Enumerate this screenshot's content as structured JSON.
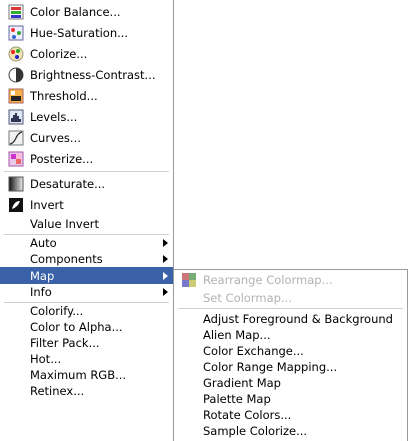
{
  "main_menu": {
    "items": [
      {
        "label": "Color Balance...",
        "icon": "color-balance-icon"
      },
      {
        "label": "Hue-Saturation...",
        "icon": "hue-saturation-icon"
      },
      {
        "label": "Colorize...",
        "icon": "colorize-icon"
      },
      {
        "label": "Brightness-Contrast...",
        "icon": "brightness-contrast-icon"
      },
      {
        "label": "Threshold...",
        "icon": "threshold-icon"
      },
      {
        "label": "Levels...",
        "icon": "levels-icon"
      },
      {
        "label": "Curves...",
        "icon": "curves-icon"
      },
      {
        "label": "Posterize...",
        "icon": "posterize-icon"
      },
      {
        "label": "Desaturate...",
        "icon": "desaturate-icon"
      },
      {
        "label": "Invert",
        "icon": "invert-icon"
      },
      {
        "label": "Value Invert"
      },
      {
        "label": "Auto",
        "submenu": true
      },
      {
        "label": "Components",
        "submenu": true
      },
      {
        "label": "Map",
        "submenu": true,
        "active": true
      },
      {
        "label": "Info",
        "submenu": true
      },
      {
        "label": "Colorify..."
      },
      {
        "label": "Color to Alpha..."
      },
      {
        "label": "Filter Pack..."
      },
      {
        "label": "Hot..."
      },
      {
        "label": "Maximum RGB..."
      },
      {
        "label": "Retinex..."
      }
    ]
  },
  "map_submenu": {
    "items": [
      {
        "label": "Rearrange Colormap...",
        "disabled": true,
        "icon": "rearrange-colormap-icon"
      },
      {
        "label": "Set Colormap...",
        "disabled": true
      },
      {
        "label": "Adjust Foreground & Background"
      },
      {
        "label": "Alien Map..."
      },
      {
        "label": "Color Exchange..."
      },
      {
        "label": "Color Range Mapping..."
      },
      {
        "label": "Gradient Map"
      },
      {
        "label": "Palette Map"
      },
      {
        "label": "Rotate Colors..."
      },
      {
        "label": "Sample Colorize..."
      }
    ]
  },
  "colors": {
    "highlight": "#3b61a8",
    "disabled_text": "#b2b2b2",
    "separator": "#cfcfcf"
  }
}
